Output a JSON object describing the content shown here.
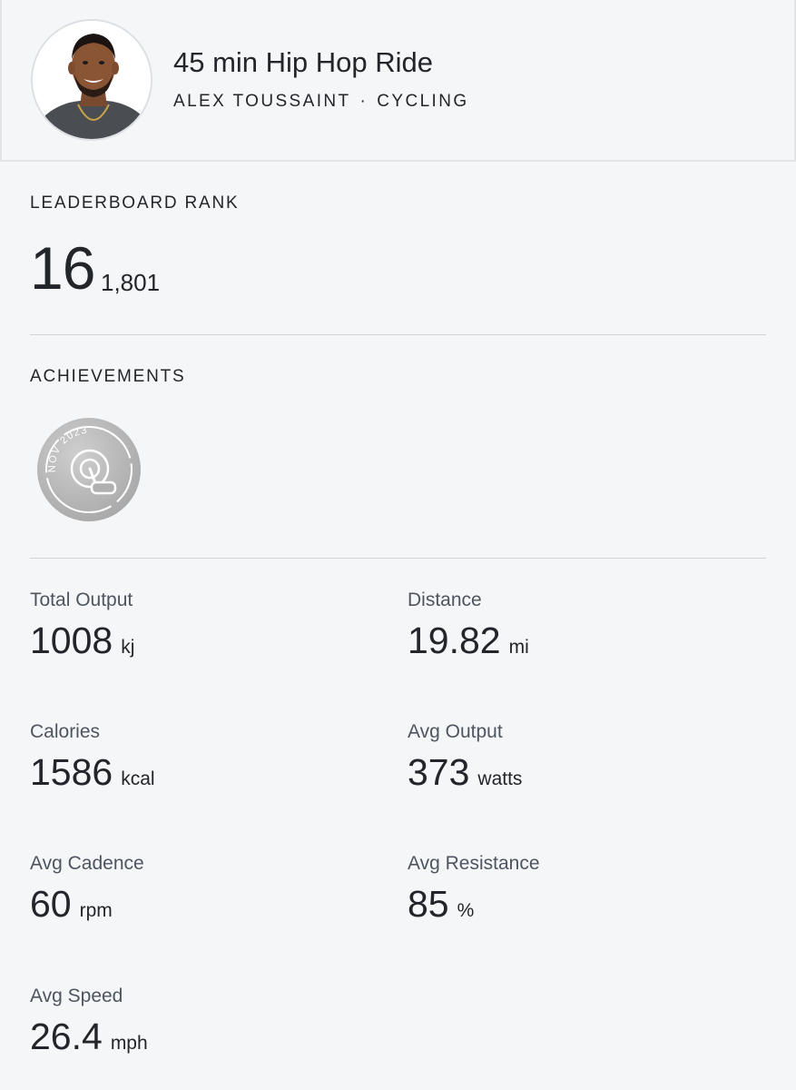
{
  "header": {
    "title": "45 min Hip Hop Ride",
    "instructor": "ALEX TOUSSAINT",
    "separator": "·",
    "discipline": "CYCLING"
  },
  "leaderboard": {
    "label": "LEADERBOARD RANK",
    "rank": "16",
    "total": "1,801"
  },
  "achievements": {
    "label": "ACHIEVEMENTS",
    "badge_text": "NOV 2023",
    "badge_icon": "cycling-challenge-badge-icon"
  },
  "metrics": [
    {
      "label": "Total Output",
      "value": "1008",
      "unit": "kj"
    },
    {
      "label": "Distance",
      "value": "19.82",
      "unit": "mi"
    },
    {
      "label": "Calories",
      "value": "1586",
      "unit": "kcal"
    },
    {
      "label": "Avg Output",
      "value": "373",
      "unit": "watts"
    },
    {
      "label": "Avg Cadence",
      "value": "60",
      "unit": "rpm"
    },
    {
      "label": "Avg Resistance",
      "value": "85",
      "unit": "%"
    },
    {
      "label": "Avg Speed",
      "value": "26.4",
      "unit": "mph"
    }
  ],
  "colors": {
    "background": "#f5f6f8",
    "text": "#222529",
    "label": "#4e5560",
    "divider": "#cfd2d6",
    "badge": "#b9b9b9"
  }
}
